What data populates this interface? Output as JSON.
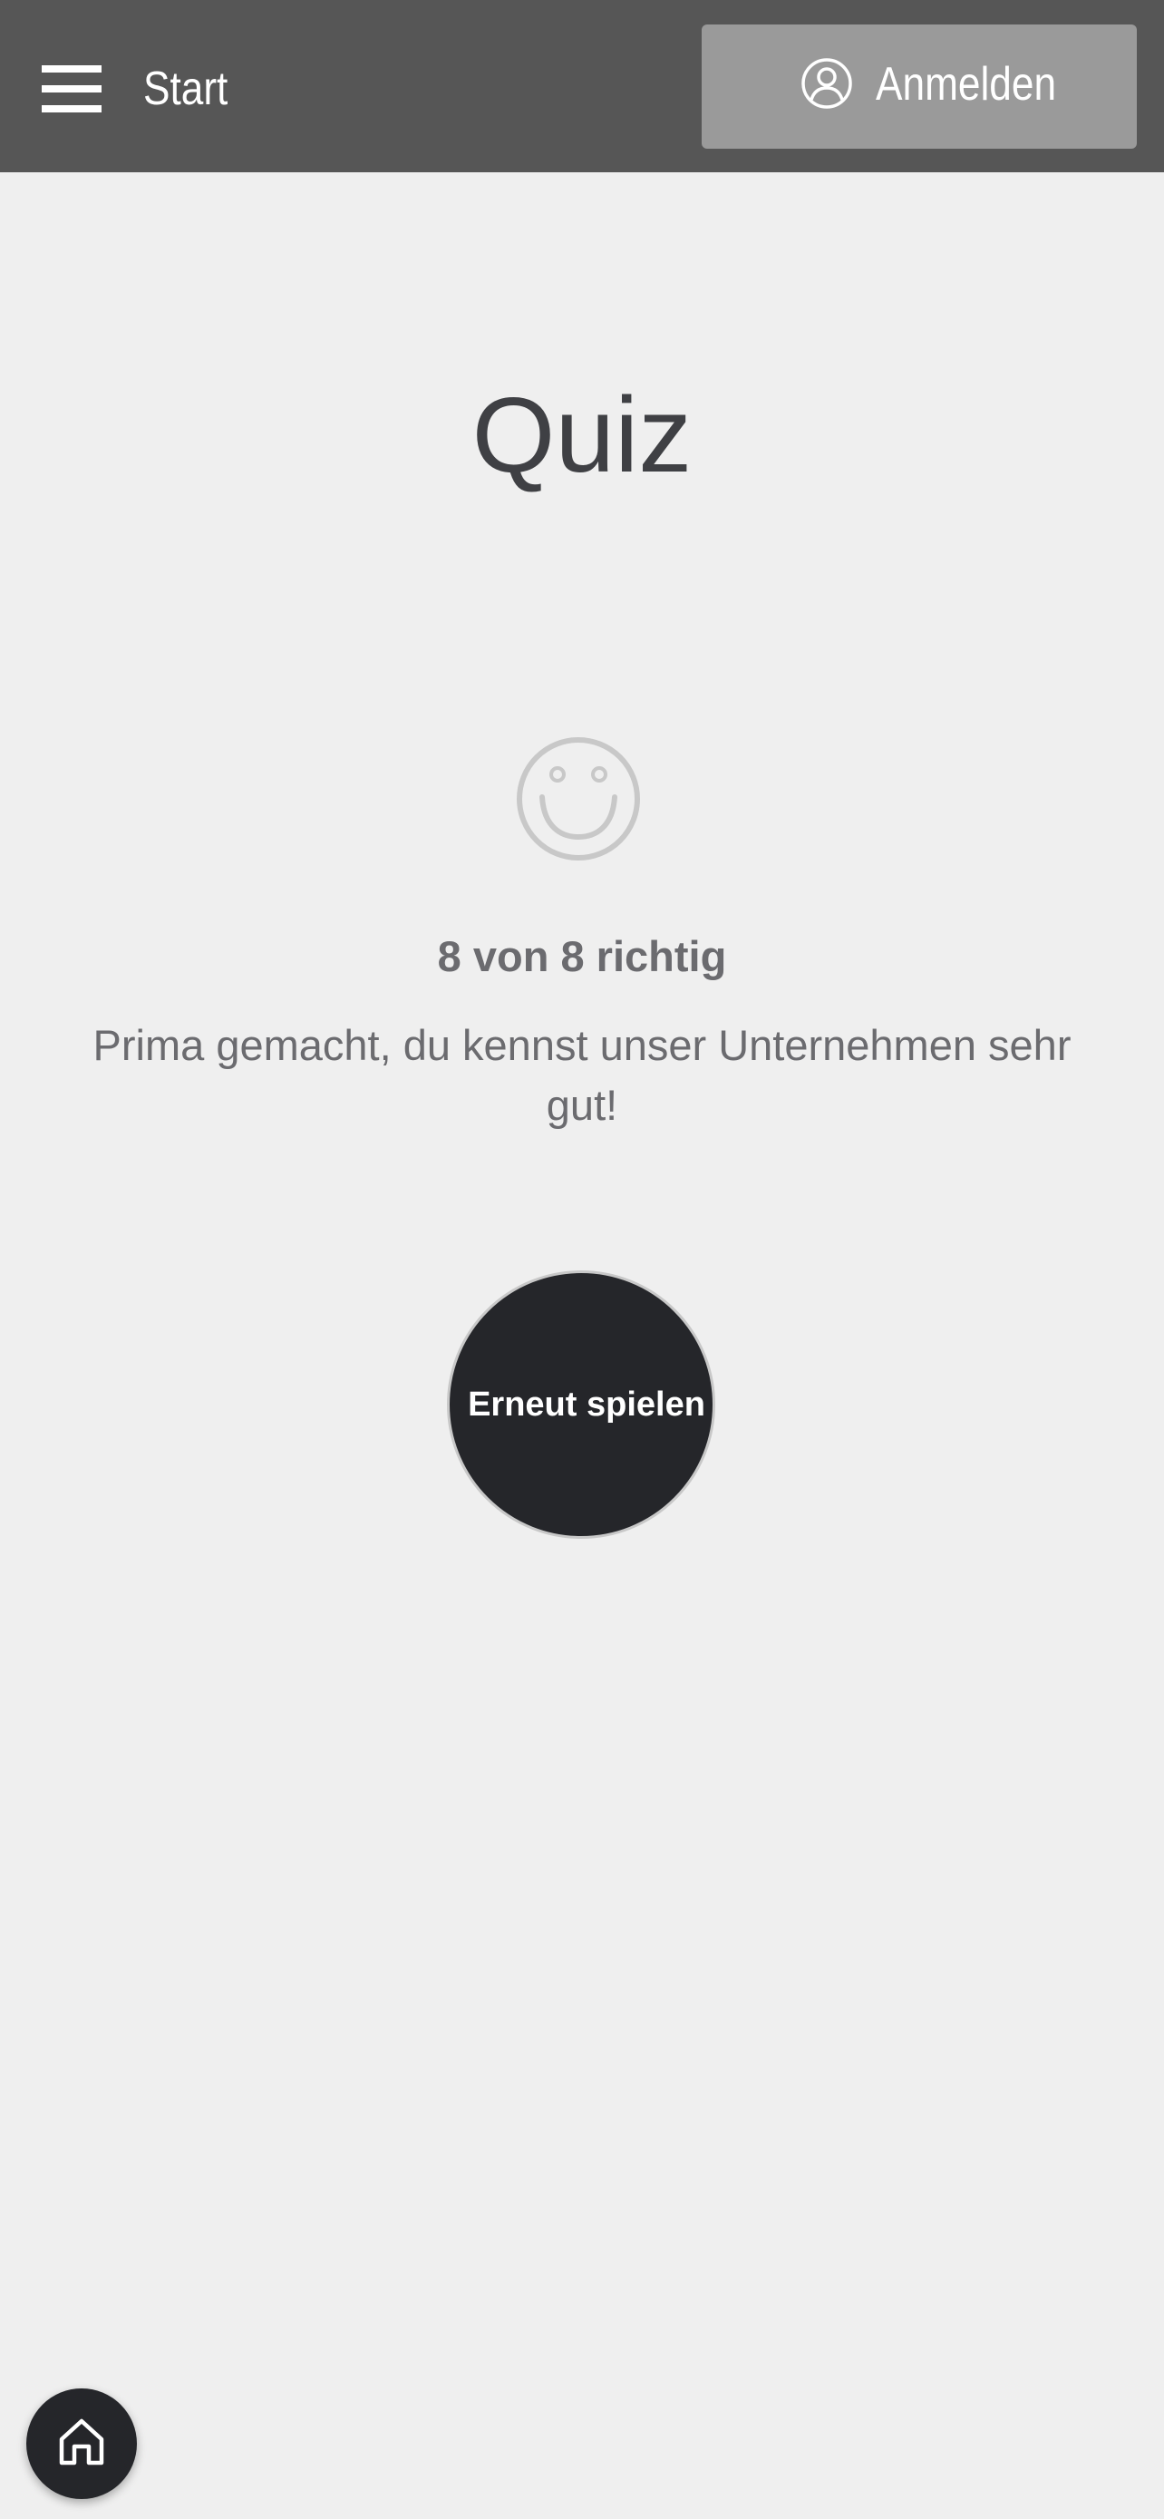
{
  "header": {
    "menu_icon": "hamburger-menu-icon",
    "title": "Start",
    "login_button": {
      "icon": "user-circle-icon",
      "label": "Anmelden"
    }
  },
  "main": {
    "title": "Quiz",
    "result_icon": "smiley-icon",
    "score": "8 von 8 richtig",
    "message": "Prima gemacht, du kennst unser Unternehmen sehr gut!",
    "replay_button": {
      "label": "Erneut spielen"
    }
  },
  "footer": {
    "home_icon": "home-icon"
  },
  "colors": {
    "header_bg": "#565656",
    "login_button_bg": "#9a9a9a",
    "page_bg": "#efefef",
    "title_text": "#3f4044",
    "body_text": "#6b6b6f",
    "button_dark": "#25262a",
    "smiley_stroke": "#c8c8c8"
  }
}
